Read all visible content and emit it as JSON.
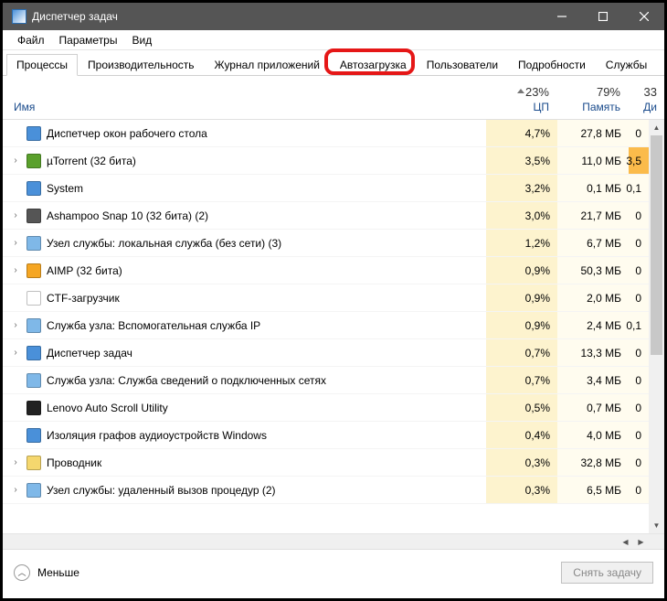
{
  "window": {
    "title": "Диспетчер задач"
  },
  "menu": {
    "file": "Файл",
    "options": "Параметры",
    "view": "Вид"
  },
  "tabs": [
    {
      "label": "Процессы",
      "active": true
    },
    {
      "label": "Производительность",
      "active": false
    },
    {
      "label": "Журнал приложений",
      "active": false
    },
    {
      "label": "Автозагрузка",
      "active": false,
      "highlighted": true
    },
    {
      "label": "Пользователи",
      "active": false
    },
    {
      "label": "Подробности",
      "active": false
    },
    {
      "label": "Службы",
      "active": false
    }
  ],
  "columns": {
    "name": "Имя",
    "cpu": {
      "pct": "23%",
      "label": "ЦП",
      "sorted": true
    },
    "mem": {
      "pct": "79%",
      "label": "Память"
    },
    "disk": {
      "pct": "33",
      "label": "Ди"
    }
  },
  "processes": [
    {
      "expand": "",
      "icon": "#4a90d9",
      "name": "Диспетчер окон рабочего стола",
      "cpu": "4,7%",
      "mem": "27,8 МБ",
      "disk": "0",
      "hot": false
    },
    {
      "expand": "›",
      "icon": "#5aa02c",
      "name": "µTorrent (32 бита)",
      "cpu": "3,5%",
      "mem": "11,0 МБ",
      "disk": "3,5",
      "hot": true
    },
    {
      "expand": "",
      "icon": "#4a90d9",
      "name": "System",
      "cpu": "3,2%",
      "mem": "0,1 МБ",
      "disk": "0,1",
      "hot": false
    },
    {
      "expand": "›",
      "icon": "#555555",
      "name": "Ashampoo Snap 10 (32 бита) (2)",
      "cpu": "3,0%",
      "mem": "21,7 МБ",
      "disk": "0",
      "hot": false
    },
    {
      "expand": "›",
      "icon": "#7fb8e8",
      "name": "Узел службы: локальная служба (без сети) (3)",
      "cpu": "1,2%",
      "mem": "6,7 МБ",
      "disk": "0",
      "hot": false
    },
    {
      "expand": "›",
      "icon": "#f5a623",
      "name": "AIMP (32 бита)",
      "cpu": "0,9%",
      "mem": "50,3 МБ",
      "disk": "0",
      "hot": false
    },
    {
      "expand": "",
      "icon": "#ffffff",
      "name": "CTF-загрузчик",
      "cpu": "0,9%",
      "mem": "2,0 МБ",
      "disk": "0",
      "hot": false
    },
    {
      "expand": "›",
      "icon": "#7fb8e8",
      "name": "Служба узла: Вспомогательная служба IP",
      "cpu": "0,9%",
      "mem": "2,4 МБ",
      "disk": "0,1",
      "hot": false
    },
    {
      "expand": "›",
      "icon": "#4a90d9",
      "name": "Диспетчер задач",
      "cpu": "0,7%",
      "mem": "13,3 МБ",
      "disk": "0",
      "hot": false
    },
    {
      "expand": "",
      "icon": "#7fb8e8",
      "name": "Служба узла: Служба сведений о подключенных сетях",
      "cpu": "0,7%",
      "mem": "3,4 МБ",
      "disk": "0",
      "hot": false
    },
    {
      "expand": "",
      "icon": "#222222",
      "name": "Lenovo Auto Scroll Utility",
      "cpu": "0,5%",
      "mem": "0,7 МБ",
      "disk": "0",
      "hot": false
    },
    {
      "expand": "",
      "icon": "#4a90d9",
      "name": "Изоляция графов аудиоустройств Windows",
      "cpu": "0,4%",
      "mem": "4,0 МБ",
      "disk": "0",
      "hot": false
    },
    {
      "expand": "›",
      "icon": "#f5d76e",
      "name": "Проводник",
      "cpu": "0,3%",
      "mem": "32,8 МБ",
      "disk": "0",
      "hot": false
    },
    {
      "expand": "›",
      "icon": "#7fb8e8",
      "name": "Узел службы: удаленный вызов процедур (2)",
      "cpu": "0,3%",
      "mem": "6,5 МБ",
      "disk": "0",
      "hot": false
    }
  ],
  "footer": {
    "fewer": "Меньше",
    "end_task": "Снять задачу"
  }
}
